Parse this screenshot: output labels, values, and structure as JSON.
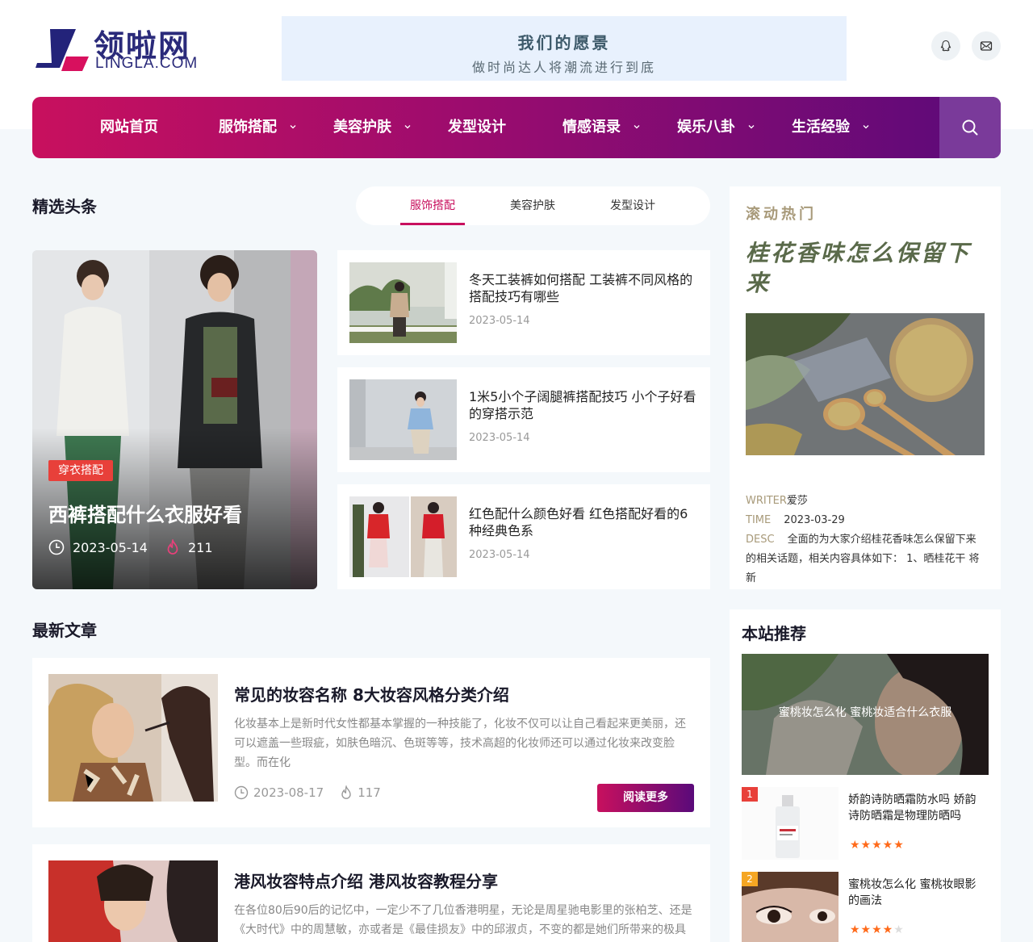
{
  "logo": {
    "cn": "领啦网",
    "en": "LINGLA.COM"
  },
  "vision": {
    "title": "我们的愿景",
    "subtitle": "做时尚达人将潮流进行到底"
  },
  "header_icons": [
    "qq-icon",
    "mail-icon"
  ],
  "nav": {
    "items": [
      {
        "label": "网站首页",
        "dropdown": false
      },
      {
        "label": "服饰搭配",
        "dropdown": true
      },
      {
        "label": "美容护肤",
        "dropdown": true
      },
      {
        "label": "发型设计",
        "dropdown": false
      },
      {
        "label": "情感语录",
        "dropdown": true
      },
      {
        "label": "娱乐八卦",
        "dropdown": true
      },
      {
        "label": "生活经验",
        "dropdown": true
      }
    ]
  },
  "featured": {
    "title": "精选头条",
    "tabs": [
      "服饰搭配",
      "美容护肤",
      "发型设计"
    ],
    "active_tab": 0,
    "hero": {
      "tag": "穿衣搭配",
      "title": "西裤搭配什么衣服好看",
      "date": "2023-05-14",
      "views": "211"
    },
    "articles": [
      {
        "title": "冬天工装裤如何搭配 工装裤不同风格的搭配技巧有哪些",
        "date": "2023-05-14"
      },
      {
        "title": "1米5小个子阔腿裤搭配技巧 小个子好看的穿搭示范",
        "date": "2023-05-14"
      },
      {
        "title": "红色配什么颜色好看 红色搭配好看的6种经典色系",
        "date": "2023-05-14"
      }
    ]
  },
  "hot": {
    "heading": "滚动热门",
    "title": "桂花香味怎么保留下来",
    "writer_label": "WRITER",
    "writer": "爱莎",
    "time_label": "TIME",
    "time": "2023-03-29",
    "desc_label": "DESC",
    "desc": "全面的为大家介绍桂花香味怎么保留下来的相关话题，相关内容具体如下： 1、晒桂花干 将新"
  },
  "latest": {
    "title": "最新文章",
    "read_more": "阅读更多",
    "items": [
      {
        "title": "常见的妆容名称 8大妆容风格分类介绍",
        "desc": "化妆基本上是新时代女性都基本掌握的一种技能了，化妆不仅可以让自己看起来更美丽，还可以遮盖一些瑕疵，如肤色暗沉、色斑等等，技术高超的化妆师还可以通过化妆来改变脸型。而在化",
        "date": "2023-08-17",
        "views": "117"
      },
      {
        "title": "港风妆容特点介绍 港风妆容教程分享",
        "desc": "在各位80后90后的记忆中，一定少不了几位香港明星，无论是周星驰电影里的张柏芝、还是《大时代》中的周慧敏，亦或者是《最佳损友》中的邱淑贞，不变的都是她们所带来的极具"
      }
    ]
  },
  "recommend": {
    "title": "本站推荐",
    "banner_caption": "蜜桃妆怎么化 蜜桃妆适合什么衣服",
    "items": [
      {
        "rank": "1",
        "title": "娇韵诗防晒霜防水吗 娇韵诗防晒霜是物理防晒吗",
        "stars": 5
      },
      {
        "rank": "2",
        "title": "蜜桃妆怎么化 蜜桃妆眼影的画法",
        "stars": 4
      }
    ]
  },
  "colors": {
    "brand": "#c8105e",
    "brand_dark": "#5a0a7a",
    "tag": "#e8403a",
    "star": "#ff6a1a"
  }
}
